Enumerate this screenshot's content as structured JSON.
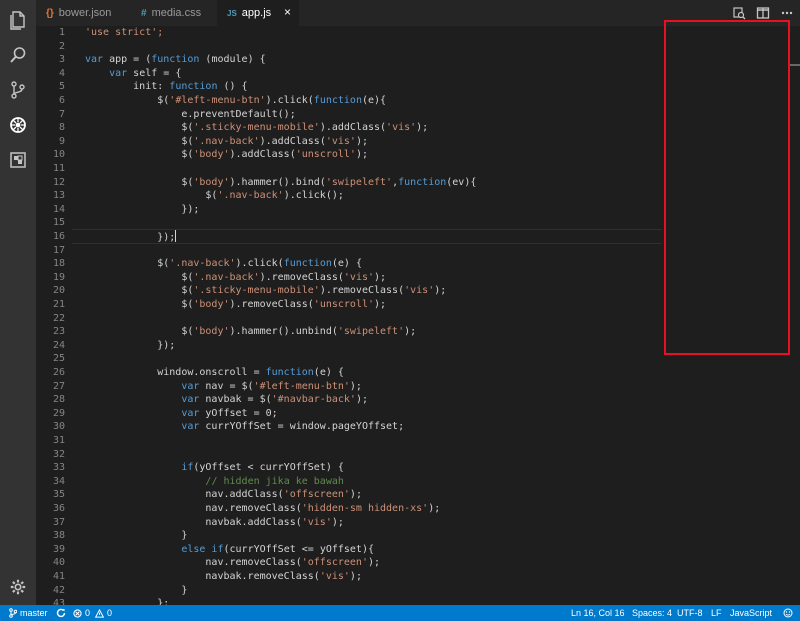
{
  "tabs": [
    {
      "label": "bower.json",
      "icon": "json-file-icon",
      "icon_glyph": "{}",
      "icon_color": "#e37933",
      "active": false
    },
    {
      "label": "media.css",
      "icon": "css-file-icon",
      "icon_glyph": "#",
      "icon_color": "#519aba",
      "active": false
    },
    {
      "label": "app.js",
      "icon": "js-file-icon",
      "icon_glyph": "JS",
      "icon_color": "#519aba",
      "active": true
    }
  ],
  "tab_close_glyph": "×",
  "activity_bar": [
    "explorer-icon",
    "search-icon",
    "source-control-icon",
    "debug-icon",
    "extensions-icon",
    "settings-gear-icon"
  ],
  "tab_actions": [
    "open-changes-icon",
    "split-editor-icon",
    "more-actions-icon"
  ],
  "editor": {
    "current_line": 16,
    "lines": [
      {
        "n": "1",
        "t": [
          [
            "s",
            "'use strict';"
          ]
        ]
      },
      {
        "n": "2",
        "t": []
      },
      {
        "n": "3",
        "t": [
          [
            "k",
            "var"
          ],
          [
            "",
            " app = ("
          ],
          [
            "k",
            "function"
          ],
          [
            "",
            " (module) {"
          ]
        ]
      },
      {
        "n": "4",
        "t": [
          [
            "",
            "    "
          ],
          [
            "k",
            "var"
          ],
          [
            "",
            " self = {"
          ]
        ]
      },
      {
        "n": "5",
        "t": [
          [
            "",
            "        init: "
          ],
          [
            "k",
            "function"
          ],
          [
            "",
            " () {"
          ]
        ]
      },
      {
        "n": "6",
        "t": [
          [
            "",
            "            $("
          ],
          [
            "s",
            "'#left-menu-btn'"
          ],
          [
            "",
            ").click("
          ],
          [
            "k",
            "function"
          ],
          [
            "",
            "(e){"
          ]
        ]
      },
      {
        "n": "7",
        "t": [
          [
            "",
            "                e.preventDefault();"
          ]
        ]
      },
      {
        "n": "8",
        "t": [
          [
            "",
            "                $("
          ],
          [
            "s",
            "'.sticky-menu-mobile'"
          ],
          [
            "",
            ").addClass("
          ],
          [
            "s",
            "'vis'"
          ],
          [
            "",
            ");"
          ]
        ]
      },
      {
        "n": "9",
        "t": [
          [
            "",
            "                $("
          ],
          [
            "s",
            "'.nav-back'"
          ],
          [
            "",
            ").addClass("
          ],
          [
            "s",
            "'vis'"
          ],
          [
            "",
            ");"
          ]
        ]
      },
      {
        "n": "10",
        "t": [
          [
            "",
            "                $("
          ],
          [
            "s",
            "'body'"
          ],
          [
            "",
            ").addClass("
          ],
          [
            "s",
            "'unscroll'"
          ],
          [
            "",
            ");"
          ]
        ]
      },
      {
        "n": "11",
        "t": []
      },
      {
        "n": "12",
        "t": [
          [
            "",
            "                $("
          ],
          [
            "s",
            "'body'"
          ],
          [
            "",
            ").hammer().bind("
          ],
          [
            "s",
            "'swipeleft'"
          ],
          [
            "",
            ","
          ],
          [
            "k",
            "function"
          ],
          [
            "",
            "(ev){"
          ]
        ]
      },
      {
        "n": "13",
        "t": [
          [
            "",
            "                    $("
          ],
          [
            "s",
            "'.nav-back'"
          ],
          [
            "",
            ").click();"
          ]
        ]
      },
      {
        "n": "14",
        "t": [
          [
            "",
            "                });"
          ]
        ]
      },
      {
        "n": "15",
        "t": []
      },
      {
        "n": "16",
        "t": [
          [
            "",
            "            });"
          ]
        ]
      },
      {
        "n": "17",
        "t": []
      },
      {
        "n": "18",
        "t": [
          [
            "",
            "            $("
          ],
          [
            "s",
            "'.nav-back'"
          ],
          [
            "",
            ").click("
          ],
          [
            "k",
            "function"
          ],
          [
            "",
            "(e) {"
          ]
        ]
      },
      {
        "n": "19",
        "t": [
          [
            "",
            "                $("
          ],
          [
            "s",
            "'.nav-back'"
          ],
          [
            "",
            ").removeClass("
          ],
          [
            "s",
            "'vis'"
          ],
          [
            "",
            ");"
          ]
        ]
      },
      {
        "n": "20",
        "t": [
          [
            "",
            "                $("
          ],
          [
            "s",
            "'.sticky-menu-mobile'"
          ],
          [
            "",
            ").removeClass("
          ],
          [
            "s",
            "'vis'"
          ],
          [
            "",
            ");"
          ]
        ]
      },
      {
        "n": "21",
        "t": [
          [
            "",
            "                $("
          ],
          [
            "s",
            "'body'"
          ],
          [
            "",
            ").removeClass("
          ],
          [
            "s",
            "'unscroll'"
          ],
          [
            "",
            ");"
          ]
        ]
      },
      {
        "n": "22",
        "t": []
      },
      {
        "n": "23",
        "t": [
          [
            "",
            "                $("
          ],
          [
            "s",
            "'body'"
          ],
          [
            "",
            ").hammer().unbind("
          ],
          [
            "s",
            "'swipeleft'"
          ],
          [
            "",
            ");"
          ]
        ]
      },
      {
        "n": "24",
        "t": [
          [
            "",
            "            });"
          ]
        ]
      },
      {
        "n": "25",
        "t": []
      },
      {
        "n": "26",
        "t": [
          [
            "",
            "            window.onscroll = "
          ],
          [
            "k",
            "function"
          ],
          [
            "",
            "(e) {"
          ]
        ]
      },
      {
        "n": "27",
        "t": [
          [
            "",
            "                "
          ],
          [
            "k",
            "var"
          ],
          [
            "",
            " nav = $("
          ],
          [
            "s",
            "'#left-menu-btn'"
          ],
          [
            "",
            ");"
          ]
        ]
      },
      {
        "n": "28",
        "t": [
          [
            "",
            "                "
          ],
          [
            "k",
            "var"
          ],
          [
            "",
            " navbak = $("
          ],
          [
            "s",
            "'#navbar-back'"
          ],
          [
            "",
            ");"
          ]
        ]
      },
      {
        "n": "29",
        "t": [
          [
            "",
            "                "
          ],
          [
            "k",
            "var"
          ],
          [
            "",
            " yOffset = 0;"
          ]
        ]
      },
      {
        "n": "30",
        "t": [
          [
            "",
            "                "
          ],
          [
            "k",
            "var"
          ],
          [
            "",
            " currYOffSet = window.pageYOffset;"
          ]
        ]
      },
      {
        "n": "31",
        "t": []
      },
      {
        "n": "32",
        "t": []
      },
      {
        "n": "33",
        "t": [
          [
            "",
            "                "
          ],
          [
            "k",
            "if"
          ],
          [
            "",
            "(yOffset < currYOffSet) {"
          ]
        ]
      },
      {
        "n": "34",
        "t": [
          [
            "",
            "                    "
          ],
          [
            "c",
            "// hidden jika ke bawah"
          ]
        ]
      },
      {
        "n": "35",
        "t": [
          [
            "",
            "                    nav.addClass("
          ],
          [
            "s",
            "'offscreen'"
          ],
          [
            "",
            ");"
          ]
        ]
      },
      {
        "n": "36",
        "t": [
          [
            "",
            "                    nav.removeClass("
          ],
          [
            "s",
            "'hidden-sm hidden-xs'"
          ],
          [
            "",
            ");"
          ]
        ]
      },
      {
        "n": "37",
        "t": [
          [
            "",
            "                    navbak.addClass("
          ],
          [
            "s",
            "'vis'"
          ],
          [
            "",
            ");"
          ]
        ]
      },
      {
        "n": "38",
        "t": [
          [
            "",
            "                }"
          ]
        ]
      },
      {
        "n": "39",
        "t": [
          [
            "",
            "                "
          ],
          [
            "k",
            "else if"
          ],
          [
            "",
            "(currYOffSet <= yOffset){"
          ]
        ]
      },
      {
        "n": "40",
        "t": [
          [
            "",
            "                    nav.removeClass("
          ],
          [
            "s",
            "'offscreen'"
          ],
          [
            "",
            ");"
          ]
        ]
      },
      {
        "n": "41",
        "t": [
          [
            "",
            "                    navbak.removeClass("
          ],
          [
            "s",
            "'vis'"
          ],
          [
            "",
            ");"
          ]
        ]
      },
      {
        "n": "42",
        "t": [
          [
            "",
            "                }"
          ]
        ]
      },
      {
        "n": "43",
        "t": [
          [
            "",
            "            };"
          ]
        ]
      }
    ]
  },
  "status_bar": {
    "branch": "master",
    "errors": "0",
    "warnings": "0",
    "position": "Ln 16, Col 16",
    "spaces": "Spaces: 4",
    "encoding": "UTF-8",
    "eol": "LF",
    "language": "JavaScript"
  },
  "colors": {
    "status_bar": "#007acc",
    "editor_bg": "#1e1e1e",
    "keyword": "#569cd6",
    "string": "#ce9178",
    "comment": "#608b4e",
    "annotation": "#e81123"
  }
}
